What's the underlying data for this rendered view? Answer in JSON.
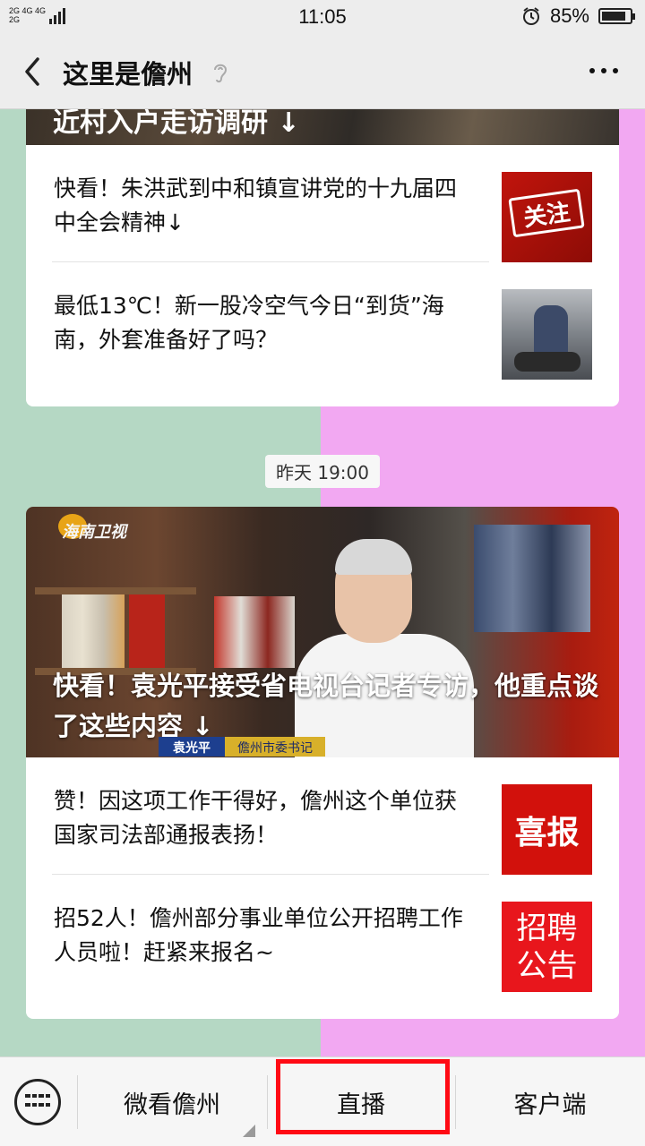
{
  "status_bar": {
    "net_top": "2G 4G 4G",
    "net_bottom": "2G",
    "time": "11:05",
    "battery_text": "85%",
    "battery_level": 0.85
  },
  "nav": {
    "title": "这里是儋州"
  },
  "card1": {
    "truncated_caption": "近村入户走访调研 ↓",
    "items": [
      {
        "title": "快看！朱洪武到中和镇宣讲党的十九届四中全会精神↓",
        "thumb_text": "关注"
      },
      {
        "title": "最低13℃！新一股冷空气今日“到货”海南，外套准备好了吗？"
      }
    ]
  },
  "timestamp": "昨天 19:00",
  "card2": {
    "hero_logo": "海南卫视",
    "hero_title": "快看！袁光平接受省电视台记者专访，他重点谈了这些内容 ↓",
    "lower_third_name": "袁光平",
    "lower_third_role": "儋州市委书记",
    "items": [
      {
        "title": "赞！因这项工作干得好，儋州这个单位获国家司法部通报表扬！",
        "thumb_text": "喜报"
      },
      {
        "title": "招52人！儋州部分事业单位公开招聘工作人员啦！赶紧来报名~",
        "thumb_line1": "招聘",
        "thumb_line2": "公告"
      }
    ]
  },
  "menu": {
    "item1": "微看儋州",
    "item2": "直播",
    "item3": "客户端"
  },
  "colors": {
    "left_bg": "#b5d8c4",
    "right_bg": "#f2a8f2",
    "highlight": "#ff0a14"
  }
}
